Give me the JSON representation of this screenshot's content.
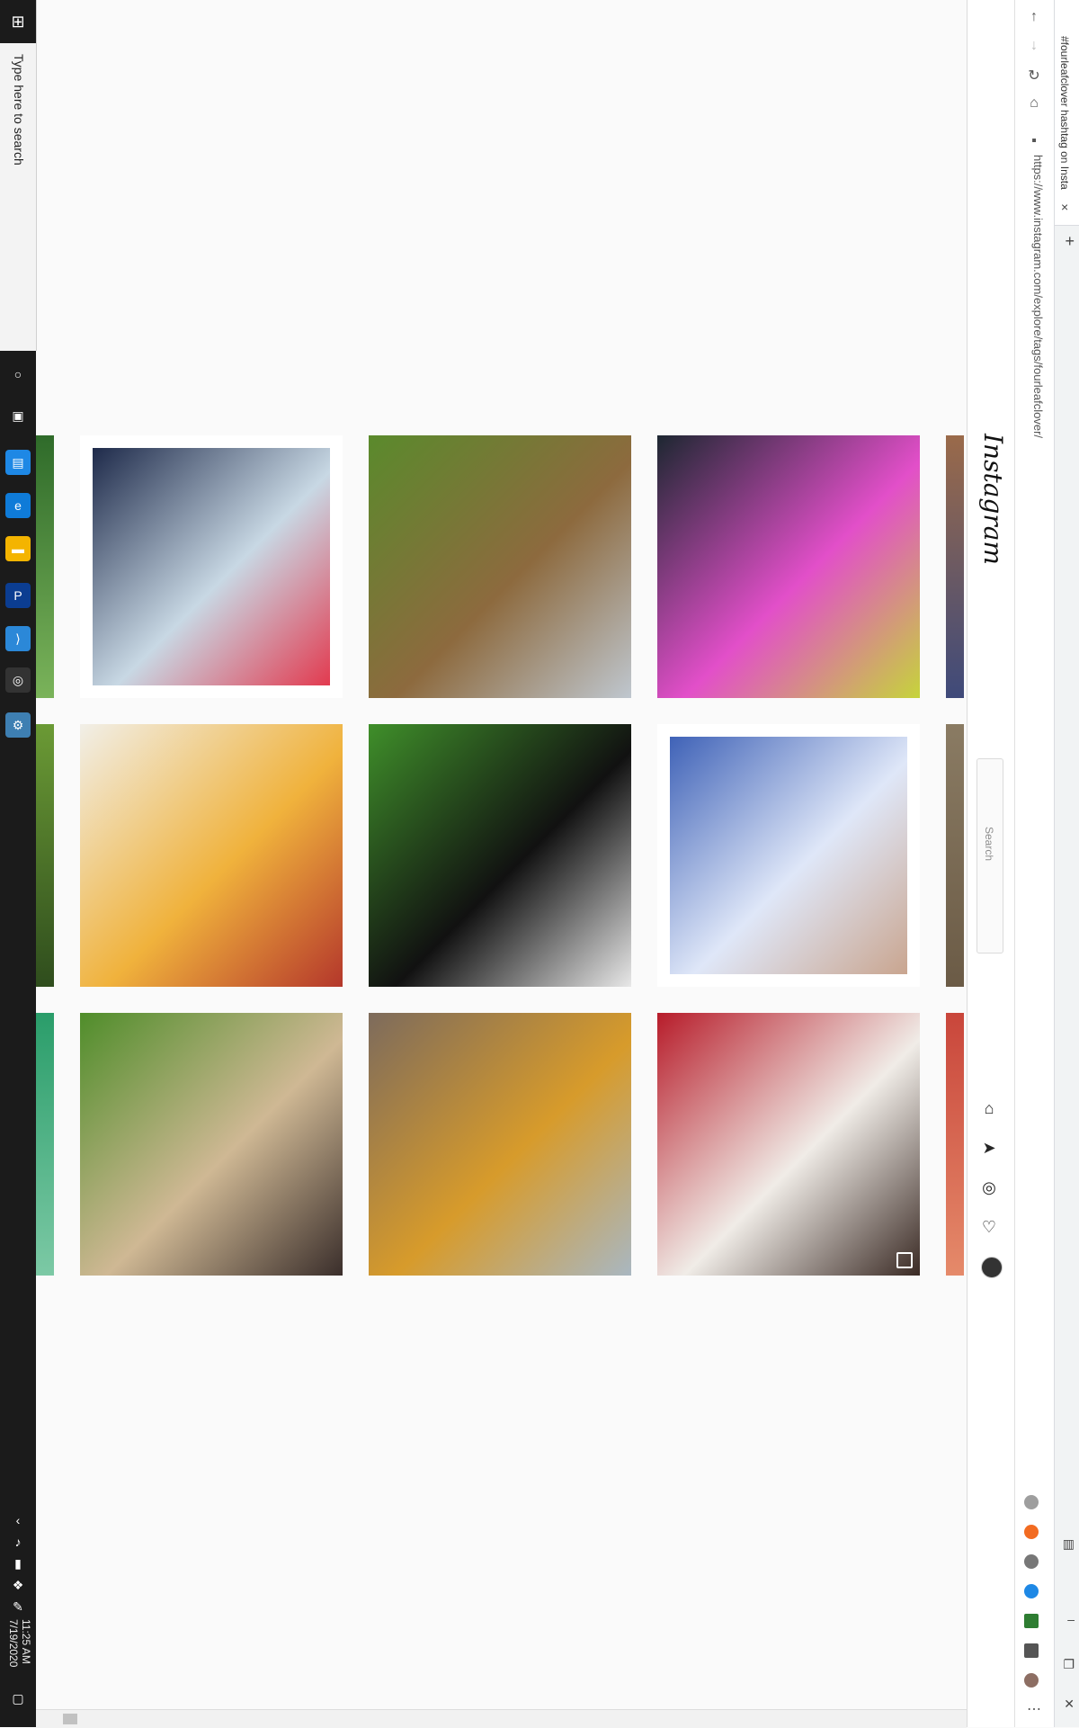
{
  "taskbar": {
    "start_glyph": "⊞",
    "search_placeholder": "Type here to search",
    "clock_time": "11:25 AM",
    "clock_date": "7/19/2020"
  },
  "browser": {
    "tab_title": "#fourleafclover hashtag on Insta",
    "address_url": "https://www.instagram.com/explore/tags/fourleafclover/",
    "new_tab_glyph": "+",
    "close_glyph": "×"
  },
  "instagram": {
    "logo_text": "Instagram",
    "search_placeholder": "Search"
  },
  "posts": [
    {
      "id": "post-1",
      "colors": [
        "#1e2a4a",
        "#c8d8e4",
        "#e23a4f"
      ]
    },
    {
      "id": "post-2",
      "colors": [
        "#5a8a2c",
        "#8d6a3e",
        "#bfc7cf"
      ]
    },
    {
      "id": "post-3",
      "colors": [
        "#1d2731",
        "#e24fc9",
        "#c6d43b"
      ]
    },
    {
      "id": "post-4",
      "colors": [
        "#f1efe8",
        "#f0b23c",
        "#b4372b"
      ]
    },
    {
      "id": "post-5",
      "colors": [
        "#3f8f2a",
        "#111111",
        "#e8e8e8"
      ]
    },
    {
      "id": "post-6",
      "colors": [
        "#3f62b7",
        "#dfe7f8",
        "#c9a58f"
      ]
    },
    {
      "id": "post-7",
      "colors": [
        "#4f8d2a",
        "#cfb894",
        "#3a2e2b"
      ]
    },
    {
      "id": "post-8",
      "colors": [
        "#7d6b5c",
        "#d79b2b",
        "#a9b7c1"
      ]
    },
    {
      "id": "post-9",
      "colors": [
        "#b71c2a",
        "#f0ece7",
        "#3a2a24"
      ]
    }
  ]
}
